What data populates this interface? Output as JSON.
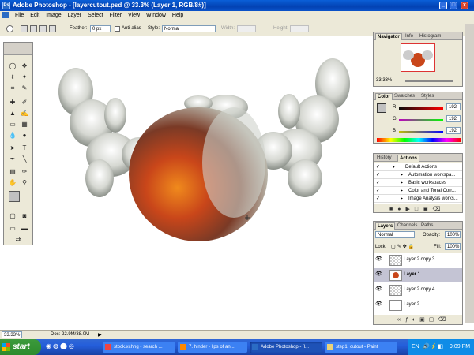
{
  "titlebar": {
    "title": "Adobe Photoshop - [layercutout.psd @ 33.3% (Layer 1, RGB/8#)]",
    "min": "_",
    "max": "□",
    "close": "x"
  },
  "menu": [
    "File",
    "Edit",
    "Image",
    "Layer",
    "Select",
    "Filter",
    "View",
    "Window",
    "Help"
  ],
  "options": {
    "feather_label": "Feather:",
    "feather_value": "0 px",
    "antialias_label": "Anti-alias",
    "style_label": "Style:",
    "style_value": "Normal",
    "width_label": "Width:",
    "height_label": "Height:"
  },
  "navigator": {
    "tabs": [
      "Navigator",
      "Info",
      "Histogram"
    ],
    "zoom": "33.33%"
  },
  "color": {
    "tabs": [
      "Color",
      "Swatches",
      "Styles"
    ],
    "r_label": "R",
    "g_label": "G",
    "b_label": "B",
    "r": "192",
    "g": "192",
    "b": "192"
  },
  "actions": {
    "tabs": [
      "History",
      "Actions"
    ],
    "items": [
      "Default Actions",
      "Automation workspa...",
      "Basic workspaces",
      "Color and Tonal Corr...",
      "Image Analysis works..."
    ]
  },
  "layers": {
    "tabs": [
      "Layers",
      "Channels",
      "Paths"
    ],
    "blend": "Normal",
    "opacity_label": "Opacity:",
    "opacity": "100%",
    "lock_label": "Lock:",
    "fill_label": "Fill:",
    "fill": "100%",
    "rows": [
      "Layer 2 copy 3",
      "Layer 1",
      "Layer 2 copy 4",
      "Layer 2"
    ]
  },
  "status": {
    "zoom": "33.33%",
    "doc": "Doc: 22.9M/38.0M"
  },
  "taskbar": {
    "start": "start",
    "tasks": [
      "stock.xchng - search ...",
      "7. hinder - lips of an ...",
      "Adobe Photoshop - [l...",
      "step1_cutout - Paint"
    ],
    "tray_lang": "EN",
    "clock": "9:09 PM"
  },
  "colors": {
    "accent": "#0a5fd8",
    "panel_bg": "#ece9d8",
    "taskbar": "#245edb"
  }
}
